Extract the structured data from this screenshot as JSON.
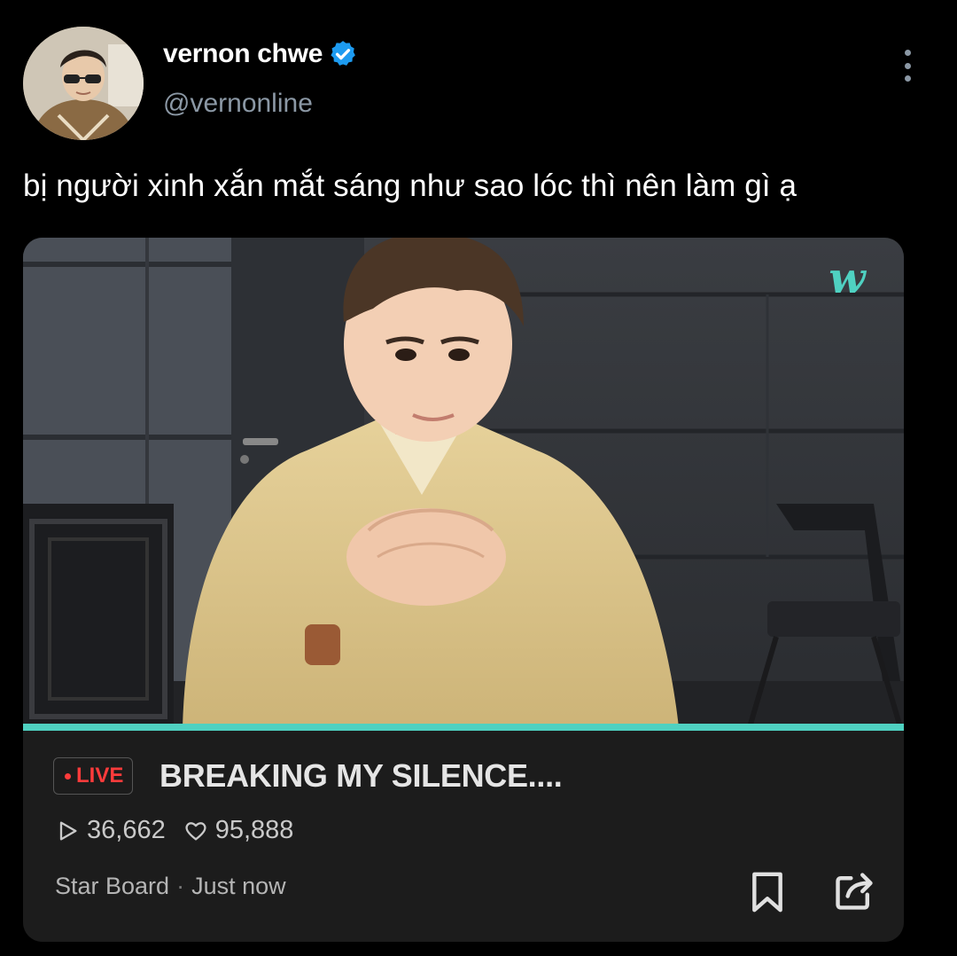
{
  "tweet": {
    "author": {
      "display_name": "vernon chwe",
      "handle": "@vernonline",
      "verified": true
    },
    "text": "bị người xinh xắn mắt sáng như sao lóc thì nên làm gì ạ"
  },
  "media": {
    "logo": "w",
    "live_label": "LIVE",
    "title": "BREAKING MY SILENCE....",
    "plays": "36,662",
    "likes": "95,888",
    "channel": "Star Board",
    "separator": "·",
    "time": "Just now"
  },
  "icons": {
    "verified": "verified-badge-icon",
    "more": "more-options-icon",
    "play": "play-count-icon",
    "heart": "heart-icon",
    "bookmark": "bookmark-icon",
    "share": "share-icon"
  },
  "colors": {
    "background": "#000000",
    "verified_blue": "#1d9bf0",
    "live_red": "#ff3b3b",
    "accent_teal": "#4fd1c1"
  }
}
